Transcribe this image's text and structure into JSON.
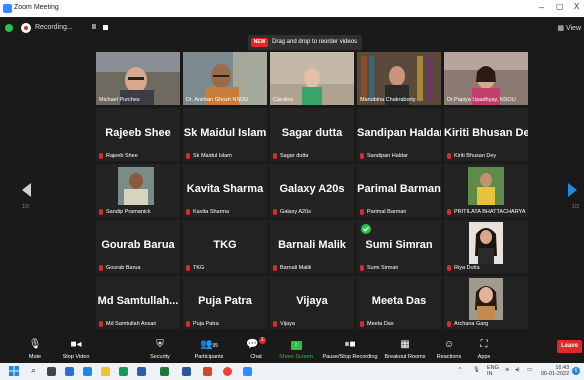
{
  "window": {
    "title": "Zoom Meeting",
    "minimize": "–",
    "maximize": "▢",
    "close": "X"
  },
  "infobar": {
    "recording": "Recording...",
    "pause": "II",
    "view": "View"
  },
  "tooltip": {
    "badge": "NEW",
    "text": "Drag and drop to reorder videos"
  },
  "row1": [
    {
      "name": "Michael Purches",
      "active": true,
      "photo": "video-man-glasses"
    },
    {
      "name": "Dr. Anirban Ghosh NSOU",
      "photo": "video-man-office"
    },
    {
      "name": "Caroline",
      "photo": "video-woman-room"
    },
    {
      "name": "Manobina Chakraborty",
      "photo": "video-bookshelf"
    },
    {
      "name": "Dr.Papiya Upadhyay, NSOU",
      "photo": "video-woman-smile"
    }
  ],
  "rows": [
    [
      {
        "big": "Rajeeb Shee",
        "label": "Rajeeb Shee"
      },
      {
        "big": "Sk Maidul Islam",
        "label": "Sk Maidul Islam"
      },
      {
        "big": "Sagar dutta",
        "label": "Sagar dutta"
      },
      {
        "big": "Sandipan Haldar",
        "label": "Sandipan Haldar"
      },
      {
        "big": "Kiriti Bhusan Dey",
        "label": "Kiriti Bhusan Dey"
      }
    ],
    [
      {
        "big": "",
        "label": "Sandip Pramanick",
        "photo": true
      },
      {
        "big": "Kavita Sharma",
        "label": "Kavita Sharma"
      },
      {
        "big": "Galaxy A20s",
        "label": "Galaxy A20s"
      },
      {
        "big": "Parimal Barman",
        "label": "Parimal Barman"
      },
      {
        "big": "",
        "label": "PRITILATA BHATTACHARYA",
        "photo": true
      }
    ],
    [
      {
        "big": "Gourab Barua",
        "label": "Gourab Barua"
      },
      {
        "big": "TKG",
        "label": "TKG"
      },
      {
        "big": "Barnali Malik",
        "label": "Barnali Malik"
      },
      {
        "big": "Sumi Simran",
        "label": "Sumi Simran",
        "check": true
      },
      {
        "big": "",
        "label": "Riya Dutta",
        "photo": true
      }
    ],
    [
      {
        "big": "Md Samtullah...",
        "label": "Md Samtullah Ansari"
      },
      {
        "big": "Puja Patra",
        "label": "Puja Patra"
      },
      {
        "big": "Vijaya",
        "label": "Vijaya"
      },
      {
        "big": "Meeta Das",
        "label": "Meeta Das"
      },
      {
        "big": "",
        "label": "Archana Garg",
        "photo": true
      }
    ]
  ],
  "pages": {
    "left": "1/3",
    "right": "1/3"
  },
  "toolbar": {
    "mute": "Mute",
    "stop_video": "Stop Video",
    "security": "Security",
    "participants": "Participants",
    "participant_count": "95",
    "chat": "Chat",
    "chat_badge": "1",
    "share_screen": "Share Screen",
    "pause_recording": "Pause/Stop Recording",
    "breakout": "Breakout Rooms",
    "reactions": "Reactions",
    "apps": "Apps",
    "leave": "Leave"
  },
  "taskbar": {
    "lang": "ENG",
    "lang2": "IN",
    "time": "16:43",
    "date": "06-01-2022",
    "notif": "6"
  },
  "colors": {
    "accent": "#2D8CFF",
    "active": "#c6e23e",
    "mute": "#e02828",
    "share": "#27c24c"
  }
}
